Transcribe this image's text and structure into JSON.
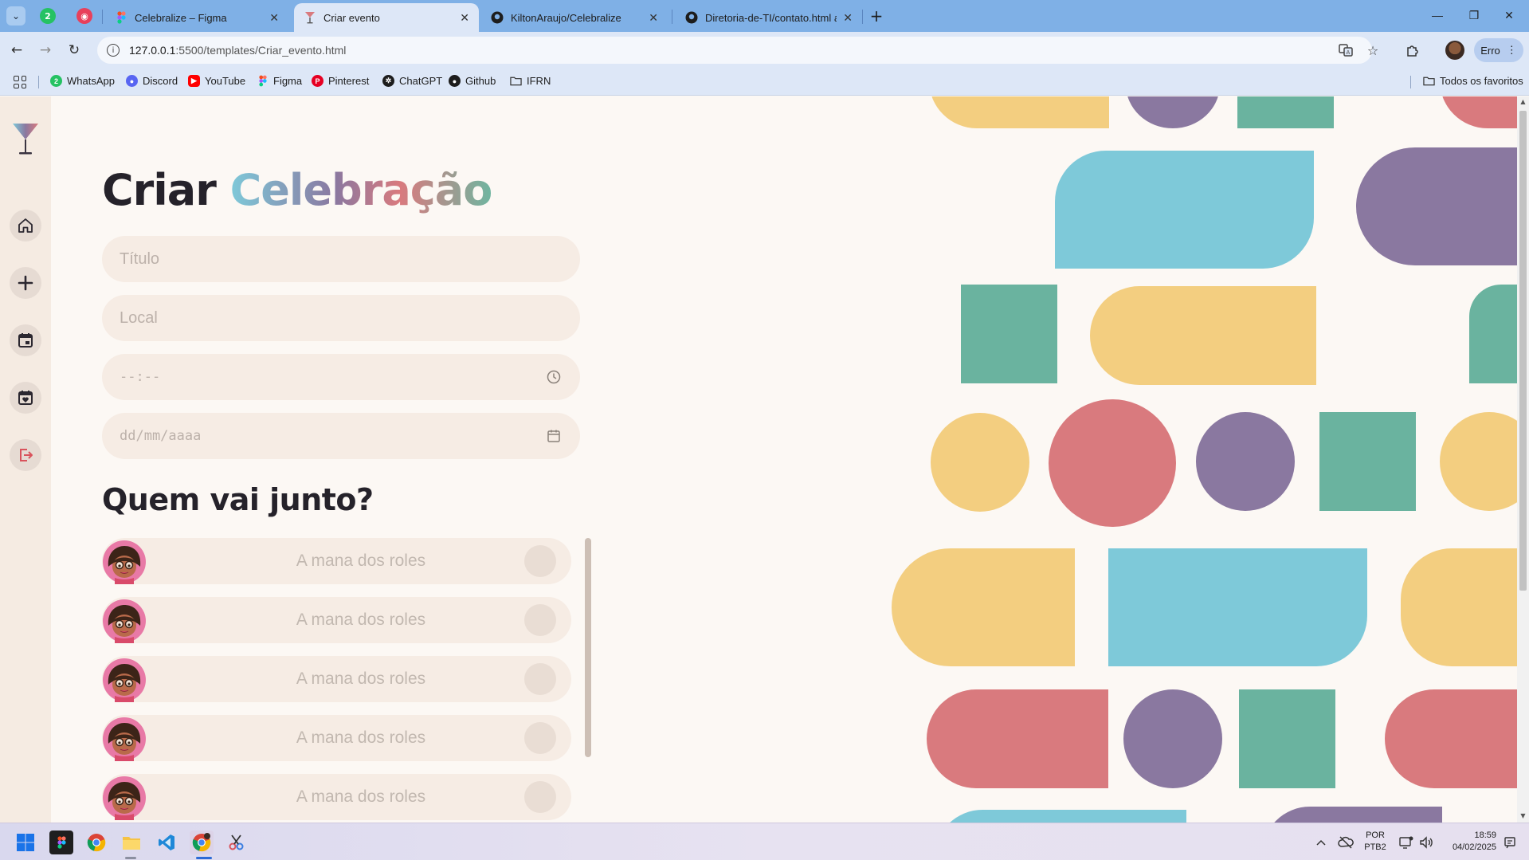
{
  "browser": {
    "tabs": [
      {
        "label": "Celebralize – Figma",
        "icon": "figma-icon",
        "active": false
      },
      {
        "label": "Criar evento",
        "icon": "cocktail-icon",
        "active": true
      },
      {
        "label": "KiltonAraujo/Celebralize",
        "icon": "github-icon",
        "active": false
      },
      {
        "label": "Diretoria-de-TI/contato.html at",
        "icon": "github-icon",
        "active": false
      }
    ],
    "pinned_badge": "2",
    "url_host": "127.0.0.1",
    "url_rest": ":5500/templates/Criar_evento.html",
    "error_button": "Erro",
    "bookmarks": [
      {
        "label": "WhatsApp",
        "icon": "whatsapp-icon"
      },
      {
        "label": "Discord",
        "icon": "discord-icon"
      },
      {
        "label": "YouTube",
        "icon": "youtube-icon"
      },
      {
        "label": "Figma",
        "icon": "figma-icon"
      },
      {
        "label": "Pinterest",
        "icon": "pinterest-icon"
      },
      {
        "label": "ChatGPT",
        "icon": "chatgpt-icon"
      },
      {
        "label": "Github",
        "icon": "github-icon"
      },
      {
        "label": "IFRN",
        "icon": "folder-icon"
      }
    ],
    "all_bookmarks": "Todos os favoritos"
  },
  "page": {
    "title_prefix": "Criar",
    "title_highlight": "Celebração",
    "fields": {
      "title_placeholder": "Título",
      "location_placeholder": "Local",
      "time_placeholder": "--:--",
      "date_placeholder": "dd/mm/aaaa"
    },
    "companions_heading": "Quem vai junto?",
    "companions": [
      {
        "name": "A mana dos roles"
      },
      {
        "name": "A mana dos roles"
      },
      {
        "name": "A mana dos roles"
      },
      {
        "name": "A mana dos roles"
      },
      {
        "name": "A mana dos roles"
      }
    ],
    "nav": [
      "home-icon",
      "plus-icon",
      "calendar-icon",
      "calendar-heart-icon",
      "logout-icon"
    ]
  },
  "colors": {
    "yellow": "#f3ce80",
    "purple": "#8a78a0",
    "teal": "#6ab39f",
    "blue": "#7ec9d9",
    "red": "#d97a7e",
    "field": "#f6ece4",
    "sidebar": "#f5ebe2"
  },
  "taskbar": {
    "lang_1": "POR",
    "lang_2": "PTB2",
    "time": "18:59",
    "date": "04/02/2025"
  }
}
